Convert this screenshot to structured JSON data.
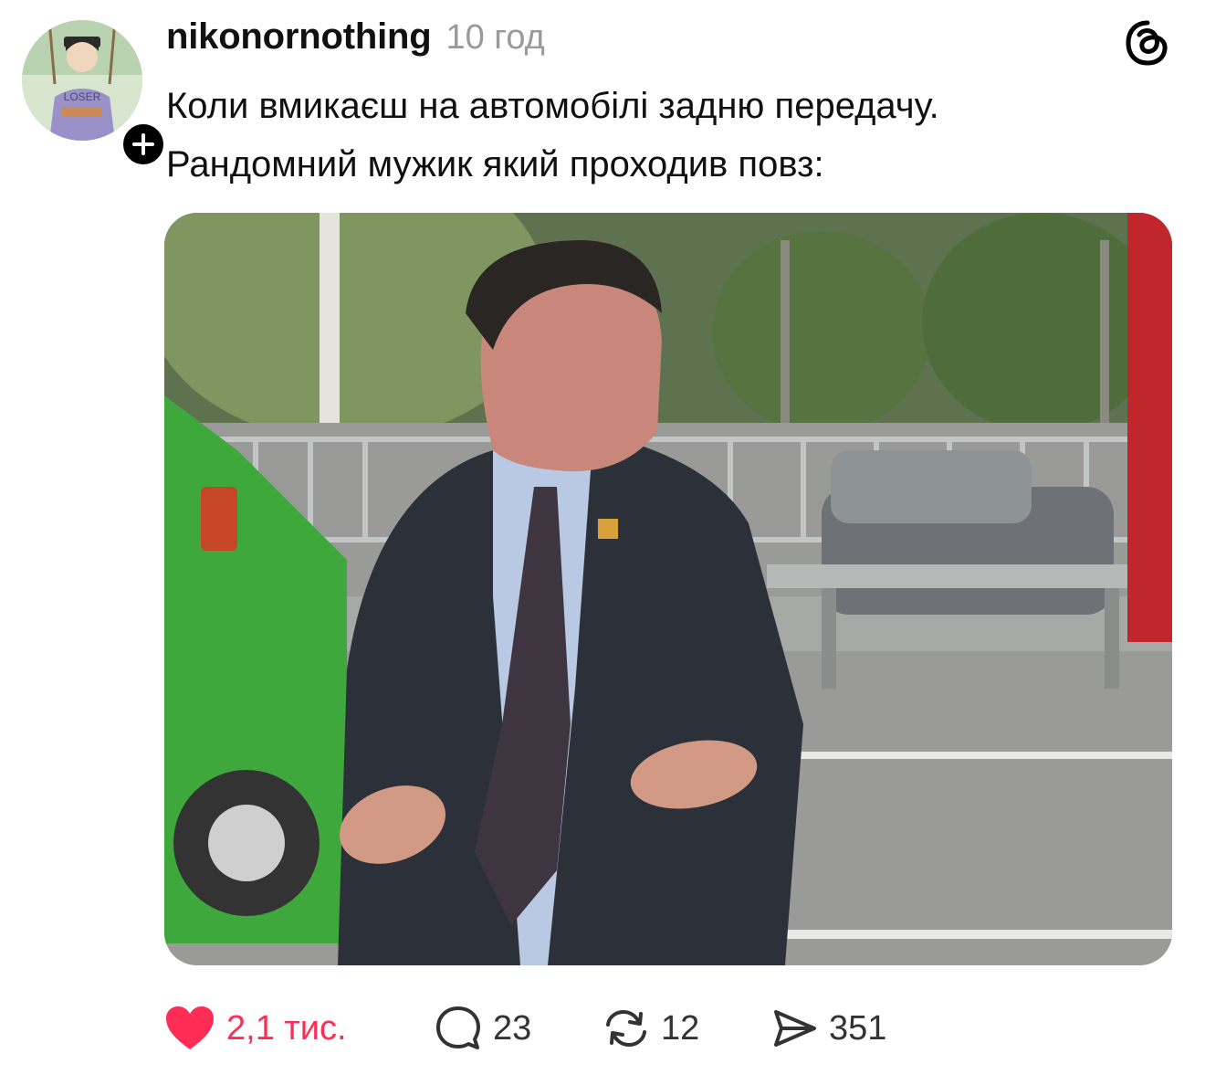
{
  "post": {
    "username": "nikonornothing",
    "timestamp": "10 год",
    "caption_lines": [
      "Коли вмикаєш на автомобілі задню передачу.",
      "Рандомний мужик який проходив повз:"
    ],
    "avatar_text": "LOSER",
    "media_icon": "photo-of-man-in-suit-gesturing-by-road"
  },
  "actions": {
    "likes": "2,1 тис.",
    "comments": "23",
    "reposts": "12",
    "shares": "351"
  },
  "icons": {
    "logo": "threads-logo-icon",
    "follow": "plus-icon",
    "like": "heart-icon",
    "comment": "comment-bubble-icon",
    "repost": "repost-icon",
    "share": "send-icon"
  },
  "colors": {
    "like_active": "#ff2d55",
    "timestamp": "#9a9a9a",
    "text": "#111111"
  }
}
